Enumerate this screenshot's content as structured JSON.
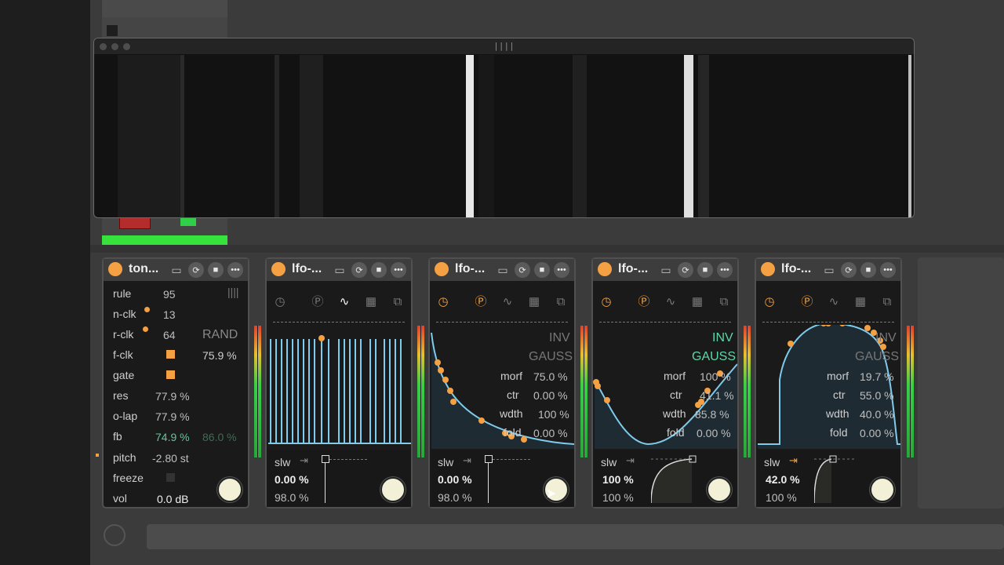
{
  "overlay": {
    "title": "||||"
  },
  "devices": [
    {
      "name": "ton...",
      "params": {
        "rule": {
          "label": "rule",
          "value": "95"
        },
        "nclk": {
          "label": "n-clk",
          "value": "13"
        },
        "rclk": {
          "label": "r-clk",
          "value": "64"
        },
        "rand": "RAND",
        "rand_value": "75.9 %",
        "fclk": {
          "label": "f-clk"
        },
        "gate": {
          "label": "gate"
        },
        "res": {
          "label": "res",
          "value": "77.9 %"
        },
        "olap": {
          "label": "o-lap",
          "value": "77.9 %"
        },
        "fb": {
          "label": "fb",
          "value": "74.9 %",
          "value2": "86.0 %"
        },
        "pitch": {
          "label": "pitch",
          "value": "-2.80 st"
        },
        "freeze": {
          "label": "freeze"
        },
        "vol": {
          "label": "vol",
          "value": "0.0 dB"
        }
      }
    },
    {
      "name": "lfo-...",
      "slw": "slw",
      "val1": "0.00 %",
      "val2": "98.0 %"
    },
    {
      "name": "lfo-...",
      "slw": "slw",
      "inv": "INV",
      "gauss": "GAUSS",
      "morf": {
        "label": "morf",
        "value": "75.0 %"
      },
      "ctr": {
        "label": "ctr",
        "value": "0.00 %"
      },
      "wdth": {
        "label": "wdth",
        "value": "100 %"
      },
      "fold": {
        "label": "fold",
        "value": "0.00 %"
      },
      "val1": "0.00 %",
      "val2": "98.0 %"
    },
    {
      "name": "lfo-...",
      "slw": "slw",
      "inv": "INV",
      "gauss": "GAUSS",
      "morf": {
        "label": "morf",
        "value": "100 %"
      },
      "ctr": {
        "label": "ctr",
        "value": "41.1 %"
      },
      "wdth": {
        "label": "wdth",
        "value": "85.8 %"
      },
      "fold": {
        "label": "fold",
        "value": "0.00 %"
      },
      "val1": "100 %",
      "val2": "100 %"
    },
    {
      "name": "lfo-...",
      "slw": "slw",
      "inv": "INV",
      "gauss": "GAUSS",
      "morf": {
        "label": "morf",
        "value": "19.7 %"
      },
      "ctr": {
        "label": "ctr",
        "value": "55.0 %"
      },
      "wdth": {
        "label": "wdth",
        "value": "40.0 %"
      },
      "fold": {
        "label": "fold",
        "value": "0.00 %"
      },
      "val1": "42.0 %",
      "val2": "100 %"
    }
  ],
  "colors": {
    "accent": "#f5a042",
    "wave": "#7ecbec",
    "meter_green": "#37e23c",
    "gauss_active": "#5fd6a8"
  },
  "icons": [
    "power-icon",
    "clock-icon",
    "preset-p-icon",
    "wave-icon",
    "grid-icon",
    "copy-icon",
    "save-icon",
    "loop-icon",
    "menu-dots-icon",
    "slew-arrow-icon"
  ]
}
